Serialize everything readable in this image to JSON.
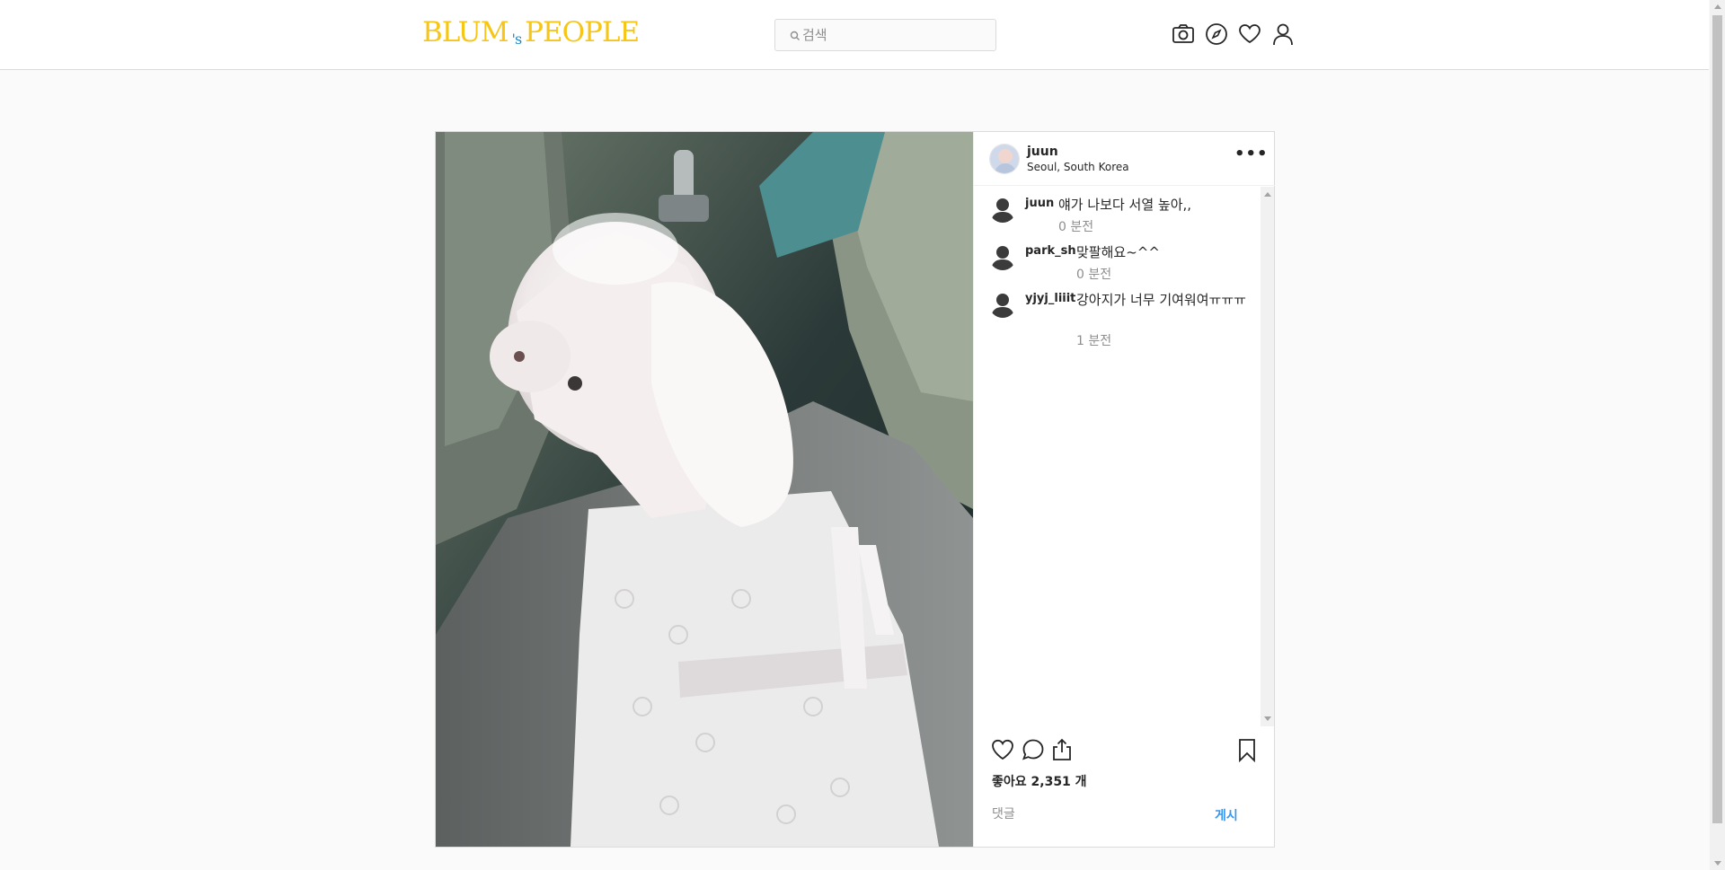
{
  "header": {
    "logo_left": "BLUM",
    "logo_mid": "'s",
    "logo_right": "PEOPLE",
    "search_placeholder": "검색",
    "icons": [
      "camera-icon",
      "compass-icon",
      "heart-icon",
      "user-icon"
    ]
  },
  "post": {
    "username": "juun",
    "location": "Seoul, South Korea",
    "more_label": "•••",
    "image_description": "white maltese dog in lace dress sitting in car",
    "comments": [
      {
        "user": "juun",
        "text": "얘가 나보다 서열 높아,,",
        "time": "0 분전"
      },
      {
        "user": "park_sh",
        "text": "맞팔해요~^^",
        "time": "0 분전"
      },
      {
        "user": "yjyj_liiit",
        "text": "강아지가 너무 기여워여ㅠㅠㅠ",
        "time": "1 분전"
      }
    ],
    "likes": "좋아요 2,351 개",
    "comment_placeholder": "댓글",
    "post_button": "게시"
  },
  "colors": {
    "brand_logo": "#f6c515",
    "accent_blue": "#3897f0",
    "muted_text": "#8e8e8e",
    "border": "#dbdbdb"
  }
}
